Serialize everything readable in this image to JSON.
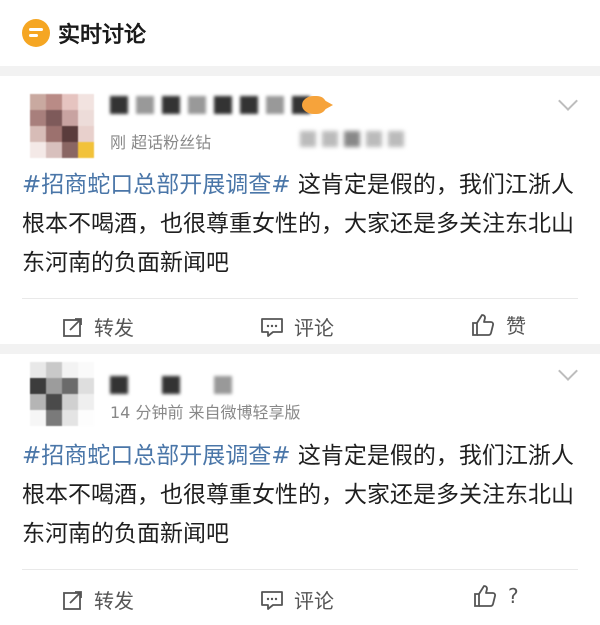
{
  "header": {
    "title": "实时讨论"
  },
  "posts": [
    {
      "meta": "刚   超话粉丝钻",
      "text_hashtag": "#招商蛇口总部开展调查#",
      "text_body": " 这肯定是假的，我们江浙人根本不喝酒，也很尊重女性的，大家还是多关注东北山东河南的负面新闻吧",
      "actions": {
        "repost": "转发",
        "comment": "评论",
        "like": "赞"
      }
    },
    {
      "meta": "14 分钟前  来自微博轻享版",
      "text_hashtag": "#招商蛇口总部开展调查#",
      "text_body": " 这肯定是假的，我们江浙人根本不喝酒，也很尊重女性的，大家还是多关注东北山东河南的负面新闻吧",
      "actions": {
        "repost": "转发",
        "comment": "评论",
        "like": "?"
      }
    }
  ],
  "colors": {
    "hashtag": "#4a76a8",
    "header_icon": "#f5a623",
    "section_gap": "#f2f2f2"
  },
  "icons": [
    "chat-bubble-icon",
    "fish-badge-icon",
    "chevron-down-icon",
    "repost-icon",
    "comment-icon",
    "thumbs-up-icon"
  ]
}
